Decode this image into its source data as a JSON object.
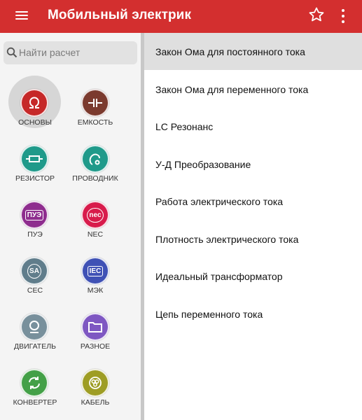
{
  "app": {
    "title": "Мобильный электрик"
  },
  "search": {
    "placeholder": "Найти расчет"
  },
  "categories": [
    {
      "label": "ОСНОВЫ",
      "color": "#c62828",
      "icon": "omega-icon",
      "selected": true
    },
    {
      "label": "ЕМКОСТЬ",
      "color": "#7b3a2e",
      "icon": "capacitor-icon"
    },
    {
      "label": "РЕЗИСТОР",
      "color": "#1f9a8a",
      "icon": "resistor-icon"
    },
    {
      "label": "ПРОВОДНИК",
      "color": "#1f9a8a",
      "icon": "conductor-icon"
    },
    {
      "label": "ПУЭ",
      "color": "#8e2c8e",
      "icon": "pue-icon",
      "badge": "ПУЭ"
    },
    {
      "label": "NEC",
      "color": "#d81b4b",
      "icon": "nec-icon",
      "badge": "nec"
    },
    {
      "label": "CEC",
      "color": "#607d8b",
      "icon": "cec-icon",
      "badge": "SA"
    },
    {
      "label": "МЭК",
      "color": "#3f51b5",
      "icon": "iec-icon",
      "badge": "IEC"
    },
    {
      "label": "ДВИГАТЕЛЬ",
      "color": "#78909c",
      "icon": "motor-icon"
    },
    {
      "label": "РАЗНОЕ",
      "color": "#7e57c2",
      "icon": "folder-icon"
    },
    {
      "label": "КОНВЕРТЕР",
      "color": "#43a047",
      "icon": "converter-icon"
    },
    {
      "label": "КАБЕЛЬ",
      "color": "#9e9d24",
      "icon": "cable-icon"
    }
  ],
  "calculations": [
    {
      "label": "Закон Ома для постоянного тока",
      "active": true
    },
    {
      "label": "Закон Ома для переменного тока"
    },
    {
      "label": "LC Резонанс"
    },
    {
      "label": "У-Д Преобразование"
    },
    {
      "label": "Работа электрического тока"
    },
    {
      "label": "Плотность электрического тока"
    },
    {
      "label": "Идеальный трансформатор"
    },
    {
      "label": "Цепь переменного тока"
    }
  ]
}
